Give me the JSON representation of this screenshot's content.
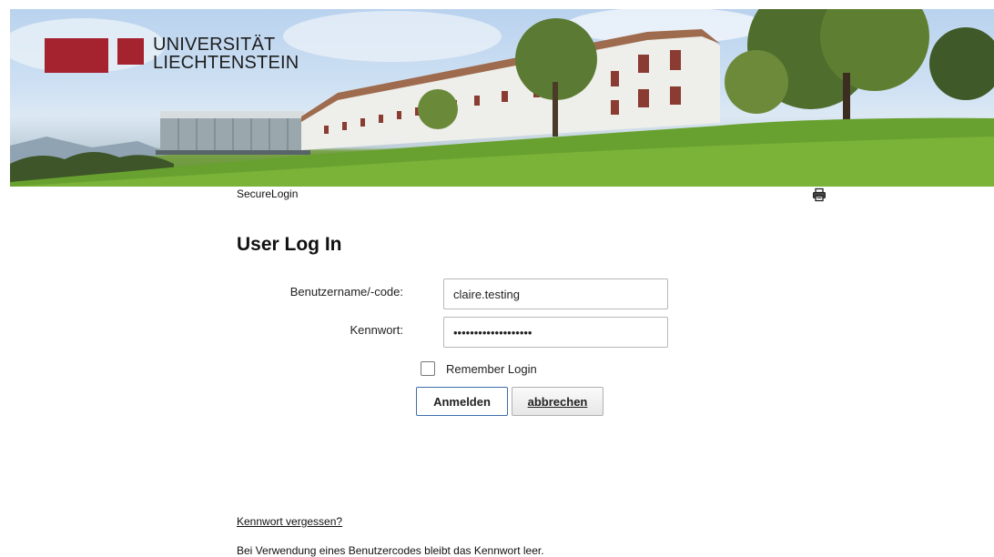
{
  "banner": {
    "logo_line1": "UNIVERSITÄT",
    "logo_line2": "LIECHTENSTEIN",
    "brand_color": "#a5222f"
  },
  "header": {
    "breadcrumb": "SecureLogin",
    "print_icon": "printer-icon"
  },
  "page": {
    "title": "User Log In"
  },
  "form": {
    "username_label": "Benutzername/-code:",
    "username_value": "claire.testing",
    "password_label": "Kennwort:",
    "password_value": "•••••••••••••••••••",
    "remember_label": "Remember Login",
    "remember_checked": false,
    "login_button": "Anmelden",
    "cancel_button": "abbrechen"
  },
  "footer": {
    "forgot_link": "Kennwort vergessen?",
    "note": "Bei Verwendung eines Benutzercodes bleibt das Kennwort leer."
  }
}
